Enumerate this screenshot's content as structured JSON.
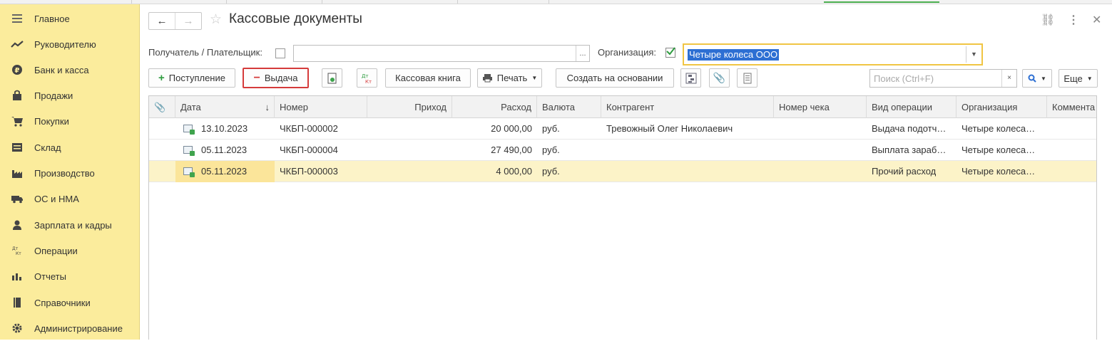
{
  "sidebar": {
    "items": [
      {
        "label": "Главное",
        "icon": "menu-icon"
      },
      {
        "label": "Руководителю",
        "icon": "trend-icon"
      },
      {
        "label": "Банк и касса",
        "icon": "coin-icon"
      },
      {
        "label": "Продажи",
        "icon": "bag-icon"
      },
      {
        "label": "Покупки",
        "icon": "cart-icon"
      },
      {
        "label": "Склад",
        "icon": "warehouse-icon"
      },
      {
        "label": "Производство",
        "icon": "factory-icon"
      },
      {
        "label": "ОС и НМА",
        "icon": "truck-icon"
      },
      {
        "label": "Зарплата и кадры",
        "icon": "person-icon"
      },
      {
        "label": "Операции",
        "icon": "dt-kt-icon"
      },
      {
        "label": "Отчеты",
        "icon": "bar-chart-icon"
      },
      {
        "label": "Справочники",
        "icon": "book-icon"
      },
      {
        "label": "Администрирование",
        "icon": "gear-icon"
      }
    ]
  },
  "header": {
    "title": "Кассовые документы",
    "back": "←",
    "forward": "→",
    "star": "☆",
    "link_icon": "⛓",
    "more_icon": "⋮",
    "close_icon": "✕"
  },
  "filters": {
    "payer_label": "Получатель / Плательщик:",
    "payer_value": "",
    "payer_dots": "...",
    "org_label": "Организация:",
    "org_checked": true,
    "org_value": "Четыре колеса ООО"
  },
  "toolbar": {
    "receipt_label": "Поступление",
    "issue_label": "Выдача",
    "dtkt_label": "Дт Кт",
    "cashbook_label": "Кассовая книга",
    "print_label": "Печать",
    "create_based_label": "Создать на основании",
    "search_placeholder": "Поиск (Ctrl+F)",
    "search_clear": "×",
    "more_label": "Еще"
  },
  "table": {
    "columns": [
      "Дата",
      "Номер",
      "Приход",
      "Расход",
      "Валюта",
      "Контрагент",
      "Номер чека",
      "Вид операции",
      "Организация",
      "Коммента"
    ],
    "sort_arrow": "↓",
    "rows": [
      {
        "date": "13.10.2023",
        "number": "ЧКБП-000002",
        "income": "",
        "expense": "20 000,00",
        "currency": "руб.",
        "counterparty": "Тревожный Олег Николаевич",
        "check": "",
        "operation": "Выдача подотч…",
        "org": "Четыре колеса…",
        "comment": ""
      },
      {
        "date": "05.11.2023",
        "number": "ЧКБП-000004",
        "income": "",
        "expense": "27 490,00",
        "currency": "руб.",
        "counterparty": "",
        "check": "",
        "operation": "Выплата зараб…",
        "org": "Четыре колеса…",
        "comment": ""
      },
      {
        "date": "05.11.2023",
        "number": "ЧКБП-000003",
        "income": "",
        "expense": "4 000,00",
        "currency": "руб.",
        "counterparty": "",
        "check": "",
        "operation": "Прочий расход",
        "org": "Четыре колеса…",
        "comment": ""
      }
    ]
  },
  "colors": {
    "sidebar_bg": "#fbec9c",
    "selected_row": "#fcf3c8",
    "highlight_border": "#d53b3b",
    "org_border": "#f0c543"
  }
}
